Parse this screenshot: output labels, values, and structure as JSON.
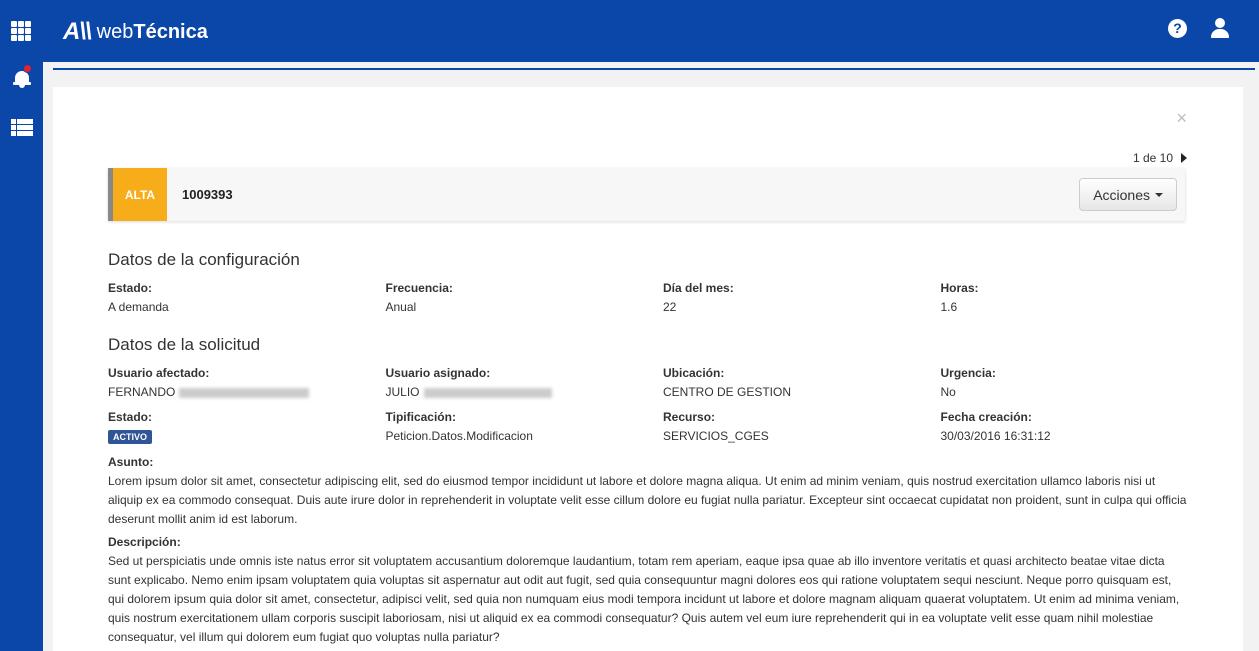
{
  "app": {
    "name_prefix": "web",
    "name_bold": "Técnica",
    "logo_mark": "A\\\\"
  },
  "top_icons": {
    "help": "?",
    "help_icon": "help-circle-icon",
    "user_icon": "user-icon"
  },
  "sidebar": {
    "items": [
      {
        "icon": "apps-grid-icon"
      },
      {
        "icon": "bell-icon",
        "has_notification": true
      },
      {
        "icon": "list-icon"
      }
    ]
  },
  "modal": {
    "close": "×",
    "pager": "1 de 10",
    "priority": "ALTA",
    "ticket_id": "1009393",
    "actions_label": "Acciones"
  },
  "config": {
    "title": "Datos de la configuración",
    "fields": [
      {
        "label": "Estado:",
        "value": "A demanda"
      },
      {
        "label": "Frecuencia:",
        "value": "Anual"
      },
      {
        "label": "Día del mes:",
        "value": "22"
      },
      {
        "label": "Horas:",
        "value": "1.6"
      }
    ]
  },
  "solicitud": {
    "title": "Datos de la solicitud",
    "row1": [
      {
        "label": "Usuario afectado:",
        "value": "FERNANDO"
      },
      {
        "label": "Usuario asignado:",
        "value": "JULIO"
      },
      {
        "label": "Ubicación:",
        "value": "CENTRO DE GESTION"
      },
      {
        "label": "Urgencia:",
        "value": "No"
      }
    ],
    "row2": [
      {
        "label": "Estado:",
        "value": "ACTIVO"
      },
      {
        "label": "Tipificación:",
        "value": "Peticion.Datos.Modificacion"
      },
      {
        "label": "Recurso:",
        "value": "SERVICIOS_CGES"
      },
      {
        "label": "Fecha creación:",
        "value": "30/03/2016 16:31:12"
      }
    ],
    "asunto_label": "Asunto:",
    "asunto": "Lorem ipsum dolor sit amet, consectetur adipiscing elit, sed do eiusmod tempor incididunt ut labore et dolore magna aliqua. Ut enim ad minim veniam, quis nostrud exercitation ullamco laboris nisi ut aliquip ex ea commodo consequat. Duis aute irure dolor in reprehenderit in voluptate velit esse cillum dolore eu fugiat nulla pariatur. Excepteur sint occaecat cupidatat non proident, sunt in culpa qui officia deserunt mollit anim id est laborum.",
    "descripcion_label": "Descripción:",
    "descripcion": "Sed ut perspiciatis unde omnis iste natus error sit voluptatem accusantium doloremque laudantium, totam rem aperiam, eaque ipsa quae ab illo inventore veritatis et quasi architecto beatae vitae dicta sunt explicabo. Nemo enim ipsam voluptatem quia voluptas sit aspernatur aut odit aut fugit, sed quia consequuntur magni dolores eos qui ratione voluptatem sequi nesciunt. Neque porro quisquam est, qui dolorem ipsum quia dolor sit amet, consectetur, adipisci velit, sed quia non numquam eius modi tempora incidunt ut labore et dolore magnam aliquam quaerat voluptatem. Ut enim ad minima veniam, quis nostrum exercitationem ullam corporis suscipit laboriosam, nisi ut aliquid ex ea commodi consequatur? Quis autem vel eum iure reprehenderit qui in ea voluptate velit esse quam nihil molestiae consequatur, vel illum qui dolorem eum fugiat quo voluptas nulla pariatur?"
  },
  "colors": {
    "brand": "#0a47a9",
    "priority_alta": "#f7ac1a",
    "badge_activo": "#2f5597",
    "notification_dot": "#e8202f"
  }
}
